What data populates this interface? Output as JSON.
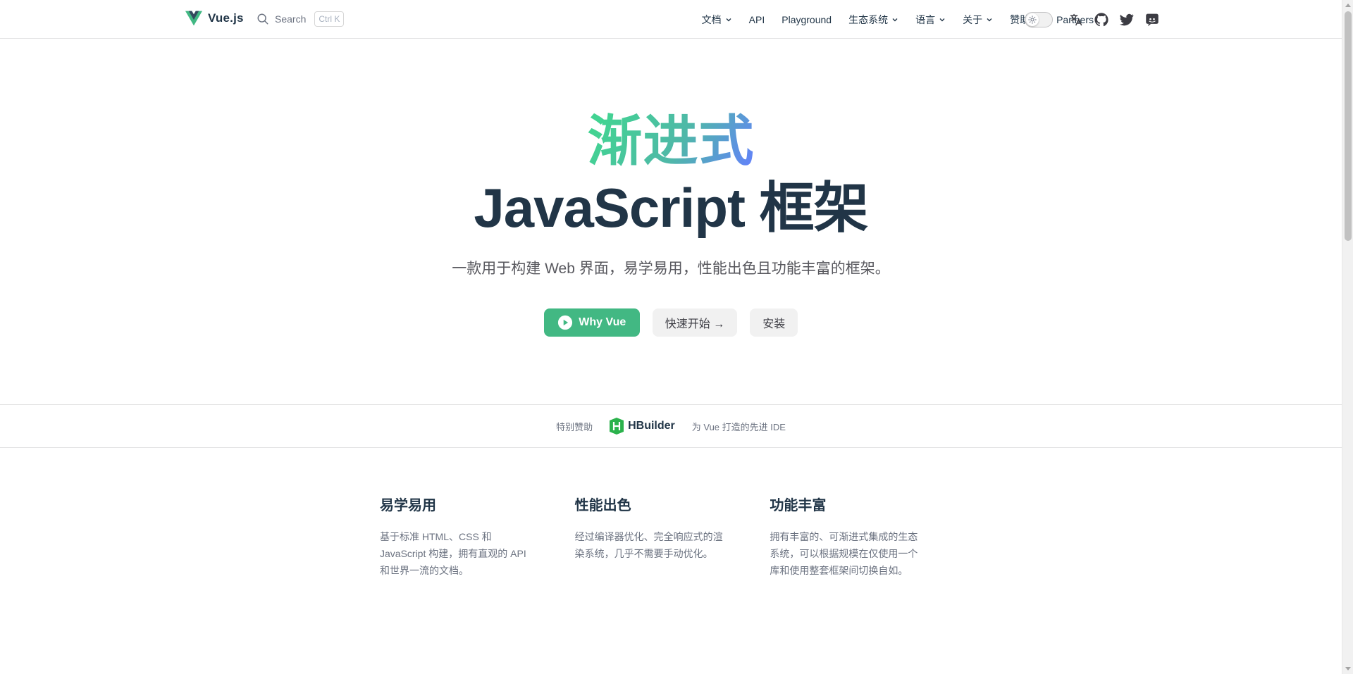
{
  "brand": {
    "name": "Vue.js",
    "icon": "vue-logo-icon"
  },
  "search": {
    "label": "Search",
    "shortcut": "Ctrl K",
    "icon": "search-icon"
  },
  "nav": {
    "items": [
      {
        "label": "文档",
        "has_dropdown": true
      },
      {
        "label": "API",
        "has_dropdown": false
      },
      {
        "label": "Playground",
        "has_dropdown": false
      },
      {
        "label": "生态系统",
        "has_dropdown": true
      },
      {
        "label": "语言",
        "has_dropdown": true
      },
      {
        "label": "关于",
        "has_dropdown": true
      },
      {
        "label": "赞助者",
        "has_dropdown": false
      },
      {
        "label": "Partners",
        "has_dropdown": false
      }
    ]
  },
  "tools": {
    "theme_toggle": "sun-icon",
    "icons": [
      "translate-icon",
      "github-icon",
      "twitter-icon",
      "discord-icon"
    ]
  },
  "hero": {
    "title_gradient": "渐进式",
    "title_main": "JavaScript 框架",
    "description": "一款用于构建 Web 界面，易学易用，性能出色且功能丰富的框架。",
    "primary_button": "Why Vue",
    "secondary_button": "快速开始 →",
    "tertiary_button": "安装"
  },
  "sponsor": {
    "label": "特别赞助",
    "name": "HBuilder",
    "tagline": "为 Vue 打造的先进 IDE"
  },
  "features": [
    {
      "title": "易学易用",
      "text": "基于标准 HTML、CSS 和 JavaScript 构建，拥有直观的 API 和世界一流的文档。"
    },
    {
      "title": "性能出色",
      "text": "经过编译器优化、完全响应式的渲染系统，几乎不需要手动优化。"
    },
    {
      "title": "功能丰富",
      "text": "拥有丰富的、可渐进式集成的生态系统，可以根据规模在仅使用一个库和使用整套框架间切换自如。"
    }
  ],
  "colors": {
    "brand_green": "#42b883",
    "gradient_start": "#42d392",
    "gradient_end": "#647eff",
    "text_dark": "#213547"
  }
}
